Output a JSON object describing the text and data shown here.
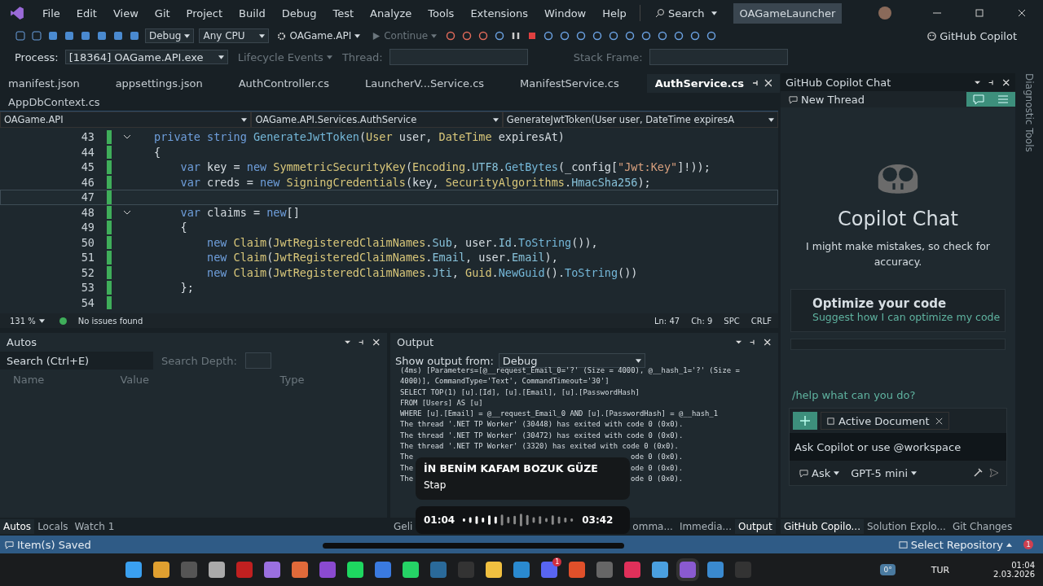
{
  "title_bar": {
    "menus": [
      "File",
      "Edit",
      "View",
      "Git",
      "Project",
      "Build",
      "Debug",
      "Test",
      "Analyze",
      "Tools",
      "Extensions",
      "Window",
      "Help"
    ],
    "search": "Search",
    "solution": "OAGameLauncher"
  },
  "toolbar": {
    "configuration": "Debug",
    "platform": "Any CPU",
    "startup": "OAGame.API",
    "continue": {
      "label": "Continue",
      "disabled": true
    },
    "copilot": "GitHub Copilot"
  },
  "debug_bar": {
    "process_label": "Process:",
    "process": "[18364] OAGame.API.exe",
    "lifecycle": {
      "label": "Lifecycle Events",
      "disabled": true
    },
    "thread_label": "Thread:",
    "stack_label": "Stack Frame:"
  },
  "editor": {
    "tabs": [
      {
        "label": "manifest.json",
        "selected": false
      },
      {
        "label": "appsettings.json",
        "selected": false
      },
      {
        "label": "AuthController.cs",
        "selected": false
      },
      {
        "label": "LauncherV...Service.cs",
        "selected": false
      },
      {
        "label": "ManifestService.cs",
        "selected": false
      },
      {
        "label": "AuthService.cs",
        "selected": true
      }
    ],
    "overflow_tabs": [
      {
        "label": "AppDbContext.cs",
        "selected": false
      }
    ],
    "navigation": [
      "OAGame.API",
      "OAGame.API.Services.AuthService",
      "GenerateJwtToken(User user, DateTime expiresA"
    ],
    "lines": [
      {
        "number": "43",
        "fold": true,
        "current": false,
        "tokens": [
          {
            "text": "private string ",
            "kind": "kw"
          },
          {
            "text": "GenerateJwtToken",
            "kind": "fn"
          },
          {
            "text": "(",
            "kind": "p"
          },
          {
            "text": "User",
            "kind": "type"
          },
          {
            "text": " user, ",
            "kind": "var"
          },
          {
            "text": "DateTime",
            "kind": "type"
          },
          {
            "text": " expiresAt)",
            "kind": "var"
          }
        ]
      },
      {
        "number": "44",
        "fold": false,
        "current": false,
        "tokens": [
          {
            "text": "{",
            "kind": "p"
          }
        ]
      },
      {
        "number": "45",
        "fold": false,
        "current": false,
        "tokens": [
          {
            "text": "    var",
            "kind": "kw"
          },
          {
            "text": " key = ",
            "kind": "var"
          },
          {
            "text": "new ",
            "kind": "kw"
          },
          {
            "text": "SymmetricSecurityKey",
            "kind": "type"
          },
          {
            "text": "(",
            "kind": "p"
          },
          {
            "text": "Encoding",
            "kind": "type"
          },
          {
            "text": ".",
            "kind": "p"
          },
          {
            "text": "UTF8",
            "kind": "member"
          },
          {
            "text": ".",
            "kind": "p"
          },
          {
            "text": "GetBytes",
            "kind": "fn"
          },
          {
            "text": "(_config[",
            "kind": "var"
          },
          {
            "text": "\"Jwt:Key\"",
            "kind": "str"
          },
          {
            "text": "]!));",
            "kind": "p"
          }
        ]
      },
      {
        "number": "46",
        "fold": false,
        "current": false,
        "tokens": [
          {
            "text": "    var",
            "kind": "kw"
          },
          {
            "text": " creds = ",
            "kind": "var"
          },
          {
            "text": "new ",
            "kind": "kw"
          },
          {
            "text": "SigningCredentials",
            "kind": "type"
          },
          {
            "text": "(key, ",
            "kind": "var"
          },
          {
            "text": "SecurityAlgorithms",
            "kind": "type"
          },
          {
            "text": ".",
            "kind": "p"
          },
          {
            "text": "HmacSha256",
            "kind": "member"
          },
          {
            "text": ");",
            "kind": "p"
          }
        ]
      },
      {
        "number": "47",
        "fold": false,
        "current": true
      },
      {
        "number": "48",
        "fold": true,
        "current": false,
        "tokens": [
          {
            "text": "    var",
            "kind": "kw"
          },
          {
            "text": " claims = ",
            "kind": "var"
          },
          {
            "text": "new",
            "kind": "kw"
          },
          {
            "text": "[]",
            "kind": "p"
          }
        ]
      },
      {
        "number": "49",
        "fold": false,
        "current": false,
        "tokens": [
          {
            "text": "    {",
            "kind": "p"
          }
        ]
      },
      {
        "number": "50",
        "fold": false,
        "current": false,
        "tokens": [
          {
            "text": "        new ",
            "kind": "kw"
          },
          {
            "text": "Claim",
            "kind": "type"
          },
          {
            "text": "(",
            "kind": "p"
          },
          {
            "text": "JwtRegisteredClaimNames",
            "kind": "type"
          },
          {
            "text": ".",
            "kind": "p"
          },
          {
            "text": "Sub",
            "kind": "member"
          },
          {
            "text": ", user.",
            "kind": "var"
          },
          {
            "text": "Id",
            "kind": "member"
          },
          {
            "text": ".",
            "kind": "p"
          },
          {
            "text": "ToString",
            "kind": "fn"
          },
          {
            "text": "()),",
            "kind": "p"
          }
        ]
      },
      {
        "number": "51",
        "fold": false,
        "current": false,
        "tokens": [
          {
            "text": "        new ",
            "kind": "kw"
          },
          {
            "text": "Claim",
            "kind": "type"
          },
          {
            "text": "(",
            "kind": "p"
          },
          {
            "text": "JwtRegisteredClaimNames",
            "kind": "type"
          },
          {
            "text": ".",
            "kind": "p"
          },
          {
            "text": "Email",
            "kind": "member"
          },
          {
            "text": ", user.",
            "kind": "var"
          },
          {
            "text": "Email",
            "kind": "member"
          },
          {
            "text": "),",
            "kind": "p"
          }
        ]
      },
      {
        "number": "52",
        "fold": false,
        "current": false,
        "tokens": [
          {
            "text": "        new ",
            "kind": "kw"
          },
          {
            "text": "Claim",
            "kind": "type"
          },
          {
            "text": "(",
            "kind": "p"
          },
          {
            "text": "JwtRegisteredClaimNames",
            "kind": "type"
          },
          {
            "text": ".",
            "kind": "p"
          },
          {
            "text": "Jti",
            "kind": "member"
          },
          {
            "text": ", ",
            "kind": "p"
          },
          {
            "text": "Guid",
            "kind": "type"
          },
          {
            "text": ".",
            "kind": "p"
          },
          {
            "text": "NewGuid",
            "kind": "fn"
          },
          {
            "text": "().",
            "kind": "p"
          },
          {
            "text": "ToString",
            "kind": "fn"
          },
          {
            "text": "())",
            "kind": "p"
          }
        ]
      },
      {
        "number": "53",
        "fold": false,
        "current": false,
        "tokens": [
          {
            "text": "    };",
            "kind": "p"
          }
        ]
      },
      {
        "number": "54",
        "fold": false,
        "current": false
      }
    ],
    "status": {
      "zoom": "131 %",
      "issues": "No issues found",
      "line": "Ln: 47",
      "column": "Ch: 9",
      "whitespace": "SPC",
      "line_ending": "CRLF"
    }
  },
  "autos": {
    "title": "Autos",
    "search_placeholder": "Search (Ctrl+E)",
    "depth_label": "Search Depth:",
    "columns": [
      "Name",
      "Value",
      "Type"
    ],
    "tabs": [
      {
        "label": "Autos",
        "selected": true
      },
      {
        "label": "Locals",
        "selected": false
      },
      {
        "label": "Watch 1",
        "selected": false
      }
    ]
  },
  "output": {
    "title": "Output",
    "source_label": "Show output from:",
    "source": "Debug",
    "lines": [
      {
        "kind": "full",
        "text": "(4ms) [Parameters=[@__request_Email_0='?' (Size = 4000), @__hash_1='?' (Size ="
      },
      {
        "kind": "full",
        "text": "4000)], CommandType='Text', CommandTimeout='30']"
      },
      {
        "kind": "full",
        "text": "SELECT TOP(1) [u].[Id], [u].[Email], [u].[PasswordHash]"
      },
      {
        "kind": "full",
        "text": "FROM [Users] AS [u]"
      },
      {
        "kind": "full",
        "text": "WHERE [u].[Email] = @__request_Email_0 AND [u].[PasswordHash] = @__hash_1"
      },
      {
        "kind": "full",
        "text": "The thread '.NET TP Worker' (30448) has exited with code 0 (0x0)."
      },
      {
        "kind": "full",
        "text": "The thread '.NET TP Worker' (30472) has exited with code 0 (0x0)."
      },
      {
        "kind": "full",
        "text": "The thread '.NET TP Worker' (3320) has exited with code 0 (0x0)."
      },
      {
        "kind": "split",
        "start": "The",
        "end": "ode 0 (0x0)."
      },
      {
        "kind": "split",
        "start": "The",
        "end": "ode 0 (0x0)."
      },
      {
        "kind": "split",
        "start": "The",
        "end": "ode 0 (0x0)."
      }
    ],
    "tabs": [
      {
        "label": "Geli",
        "selected": false
      },
      {
        "label": "omma...",
        "selected": false
      },
      {
        "label": "Immedia...",
        "selected": false
      },
      {
        "label": "Output",
        "selected": true
      }
    ]
  },
  "copilot": {
    "title": "GitHub Copilot Chat",
    "thread": "New Thread",
    "heading": "Copilot Chat",
    "disclaimer": "I might make mistakes, so check for accuracy.",
    "suggestion": {
      "title": "Optimize your code",
      "link": "Suggest how I can optimize my code"
    },
    "help": "/help what can you do?",
    "context": "Active Document",
    "input_placeholder": "Ask Copilot or use @workspace",
    "mode": "Ask",
    "model": "GPT-5 mini",
    "tabs": [
      {
        "label": "GitHub Copilo...",
        "selected": true
      },
      {
        "label": "Solution Explo...",
        "selected": false
      },
      {
        "label": "Git Changes",
        "selected": false
      }
    ],
    "side_tab": "Diagnostic Tools"
  },
  "media_popup": {
    "title": "İN BENİM KAFAM BOZUK GÜZE",
    "artist": "Stap",
    "elapsed": "01:04",
    "total": "03:42",
    "level": 0.3
  },
  "status_bar": {
    "message": "Item(s) Saved",
    "repository": "Select Repository",
    "notification_badge": "1"
  },
  "taskbar": {
    "chat_badge": "1",
    "weather": "0°",
    "language": "TUR",
    "time": "01:04",
    "date": "2.03.2026"
  }
}
